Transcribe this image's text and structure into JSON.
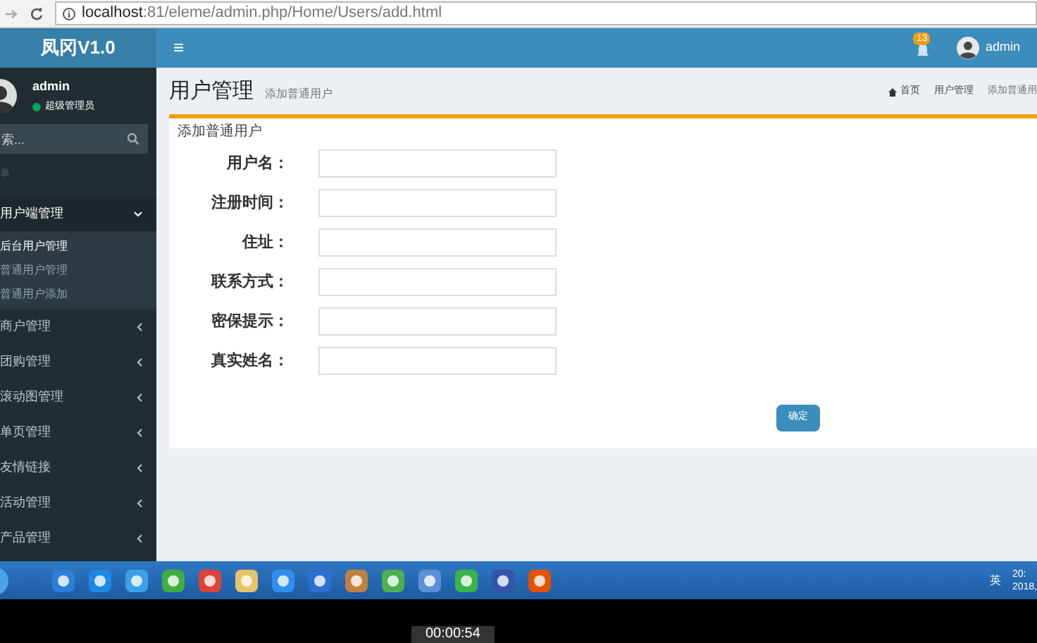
{
  "browser": {
    "url_host": "localhost",
    "url_path": ":81/eleme/admin.php/Home/Users/add.html"
  },
  "header": {
    "logo": "凤冈V1.0",
    "menu_toggle": "≡",
    "notification_count": "13",
    "user": "admin"
  },
  "sidebar": {
    "user": {
      "name": "admin",
      "role": "超级管理员",
      "online": true
    },
    "search": {
      "placeholder": "索..."
    },
    "section_label": "单",
    "items": [
      {
        "label": "用户端管理",
        "expanded": true,
        "children": [
          {
            "label": "后台用户管理",
            "selected": true
          },
          {
            "label": "普通用户管理",
            "selected": false
          },
          {
            "label": "普通用户添加",
            "selected": false
          }
        ]
      },
      {
        "label": "商户管理",
        "expanded": false
      },
      {
        "label": "团购管理",
        "expanded": false
      },
      {
        "label": "滚动图管理",
        "expanded": false
      },
      {
        "label": "单页管理",
        "expanded": false
      },
      {
        "label": "友情链接",
        "expanded": false
      },
      {
        "label": "活动管理",
        "expanded": false
      },
      {
        "label": "产品管理",
        "expanded": false
      }
    ]
  },
  "content": {
    "title": "用户管理",
    "subtitle": "添加普通用户",
    "breadcrumb": [
      "首页",
      "用户管理",
      "添加普通用"
    ],
    "box_title": "添加普通用户",
    "fields": [
      {
        "label": "用户名："
      },
      {
        "label": "注册时间："
      },
      {
        "label": "住址："
      },
      {
        "label": "联系方式："
      },
      {
        "label": "密保提示："
      },
      {
        "label": "真实姓名："
      }
    ],
    "submit": "确定"
  },
  "taskbar": {
    "tray": {
      "ime": "英",
      "time": "20:",
      "date": "2018,"
    }
  },
  "recorder": {
    "timer": "00:00:54"
  }
}
